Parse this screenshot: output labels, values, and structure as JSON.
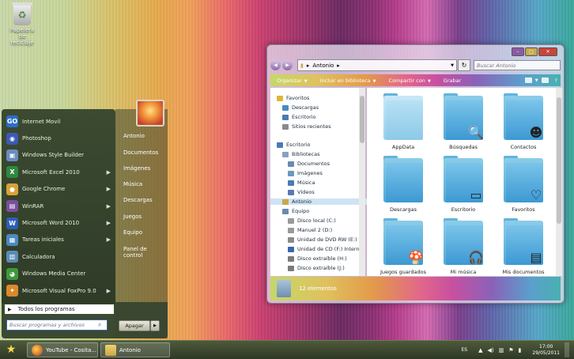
{
  "desktop": {
    "recycle_bin_label": "Papelera de reciclaje"
  },
  "start_menu": {
    "programs": [
      {
        "label": "Internet Movil",
        "icon": "go-icon",
        "color": "#2a6fc9",
        "glyph": "GO",
        "submenu": false
      },
      {
        "label": "Photoshop",
        "icon": "photoshop-icon",
        "color": "#3b5ab5",
        "glyph": "◉",
        "submenu": false
      },
      {
        "label": "Windows Style Builder",
        "icon": "style-builder-icon",
        "color": "#6a8cc0",
        "glyph": "▣",
        "submenu": false
      },
      {
        "label": "Microsoft Excel 2010",
        "icon": "excel-icon",
        "color": "#2d8a3e",
        "glyph": "X",
        "submenu": true
      },
      {
        "label": "Google Chrome",
        "icon": "chrome-icon",
        "color": "#d9a233",
        "glyph": "●",
        "submenu": true
      },
      {
        "label": "WinRAR",
        "icon": "winrar-icon",
        "color": "#7a4fa0",
        "glyph": "▤",
        "submenu": true
      },
      {
        "label": "Microsoft Word 2010",
        "icon": "word-icon",
        "color": "#2b5fb5",
        "glyph": "W",
        "submenu": true
      },
      {
        "label": "Tareas iniciales",
        "icon": "tasks-icon",
        "color": "#4a8ac0",
        "glyph": "▦",
        "submenu": true
      },
      {
        "label": "Calculadora",
        "icon": "calculator-icon",
        "color": "#5a8cb5",
        "glyph": "▥",
        "submenu": false
      },
      {
        "label": "Windows Media Center",
        "icon": "media-center-icon",
        "color": "#3c9a3c",
        "glyph": "◕",
        "submenu": false
      },
      {
        "label": "Microsoft Visual FoxPro 9.0",
        "icon": "foxpro-icon",
        "color": "#d98a2a",
        "glyph": "✦",
        "submenu": true
      }
    ],
    "all_programs_label": "Todos los programas",
    "search_placeholder": "Buscar programas y archivos",
    "right_items": [
      "Antonio",
      "Documentos",
      "Imágenes",
      "Música",
      "Descargas",
      "Juegos",
      "Equipo",
      "Panel de control"
    ],
    "shutdown_label": "Apagar"
  },
  "explorer": {
    "breadcrumb": [
      "Antonio"
    ],
    "search_placeholder": "Buscar Antonio",
    "toolbar": [
      "Organizar",
      "Incluir en biblioteca",
      "Compartir con",
      "Grabar"
    ],
    "nav_items": [
      {
        "label": "Favoritos",
        "level": 0,
        "color": "#e0b43a"
      },
      {
        "label": "Descargas",
        "level": 1,
        "color": "#4a8ac8"
      },
      {
        "label": "Escritorio",
        "level": 1,
        "color": "#4a7ab8"
      },
      {
        "label": "Sitios recientes",
        "level": 1,
        "color": "#8a8a8a"
      },
      {
        "label": "Escritorio",
        "level": 0,
        "color": "#4a7ab8"
      },
      {
        "label": "Bibliotecas",
        "level": 1,
        "color": "#8aa0c0"
      },
      {
        "label": "Documentos",
        "level": 2,
        "color": "#6a8ab0"
      },
      {
        "label": "Imágenes",
        "level": 2,
        "color": "#6a9ac0"
      },
      {
        "label": "Música",
        "level": 2,
        "color": "#4a7ab8"
      },
      {
        "label": "Vídeos",
        "level": 2,
        "color": "#5a7ab0"
      },
      {
        "label": "Antonio",
        "level": 1,
        "color": "#c9a84a",
        "selected": true
      },
      {
        "label": "Equipo",
        "level": 1,
        "color": "#6a8ab0"
      },
      {
        "label": "Disco local (C:)",
        "level": 2,
        "color": "#9a9a9a"
      },
      {
        "label": "Manuel 2 (D:)",
        "level": 2,
        "color": "#9a9a9a"
      },
      {
        "label": "Unidad de DVD RW (E:)",
        "level": 2,
        "color": "#8a8a8a"
      },
      {
        "label": "Unidad de CD (F:) Internet",
        "level": 2,
        "color": "#3a66b0"
      },
      {
        "label": "Disco extraíble (H:)",
        "level": 2,
        "color": "#7a7a7a"
      },
      {
        "label": "Disco extraíble (J:)",
        "level": 2,
        "color": "#7a7a7a"
      }
    ],
    "folders": [
      {
        "label": "AppData",
        "style": "light",
        "overlay": ""
      },
      {
        "label": "Búsquedas",
        "style": "dark",
        "overlay": "🔍"
      },
      {
        "label": "Contactos",
        "style": "dark",
        "overlay": "☻"
      },
      {
        "label": "Descargas",
        "style": "dark",
        "overlay": ""
      },
      {
        "label": "Escritorio",
        "style": "dark",
        "overlay": "▭"
      },
      {
        "label": "Favoritos",
        "style": "dark",
        "overlay": "♡"
      },
      {
        "label": "Juegos guardados",
        "style": "dark",
        "overlay": "🍄"
      },
      {
        "label": "Mi música",
        "style": "dark",
        "overlay": "🎧"
      },
      {
        "label": "Mis documentos",
        "style": "dark",
        "overlay": "▤"
      }
    ],
    "status": "12 elementos"
  },
  "taskbar": {
    "tasks": [
      {
        "label": "YouTube - Cosita...",
        "icon": "firefox-icon",
        "color": "#e07a2a"
      },
      {
        "label": "Antonio",
        "icon": "explorer-icon",
        "color": "#c9a84a"
      }
    ],
    "language": "ES",
    "time": "17:00",
    "date": "29/05/2011"
  }
}
